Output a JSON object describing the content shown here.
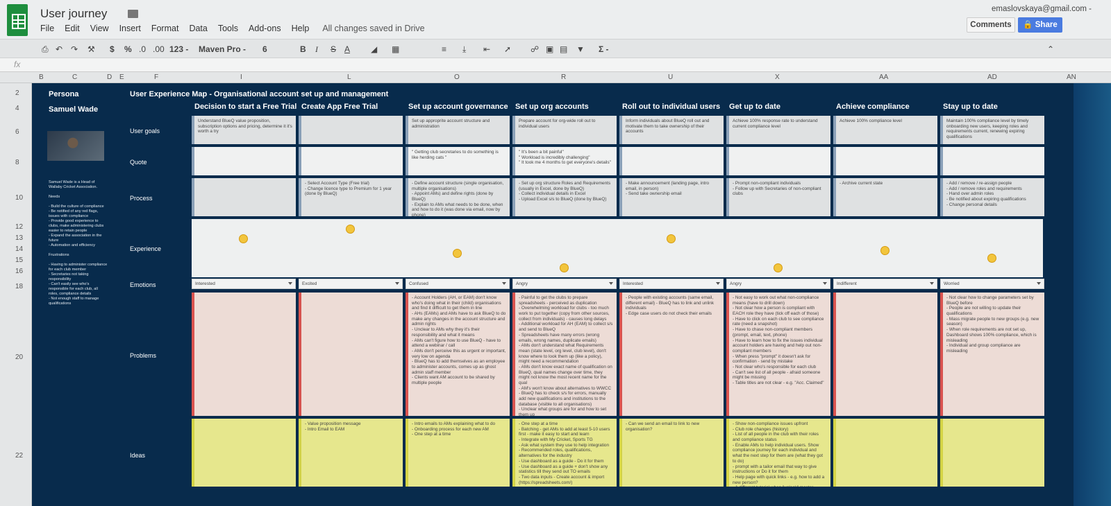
{
  "app": {
    "title": "User journey",
    "menu": [
      "File",
      "Edit",
      "View",
      "Insert",
      "Format",
      "Data",
      "Tools",
      "Add-ons",
      "Help"
    ],
    "saved_status": "All changes saved in Drive",
    "account_email": "emaslovskaya@gmail.com -",
    "comments_label": "Comments",
    "share_label": "Share"
  },
  "toolbar": {
    "currency": "$",
    "percent": "%",
    "dec_decrease": ".0",
    "dec_increase": ".00",
    "format_more": "123 -",
    "font": "Maven Pro -",
    "font_size": "6",
    "bold": "B",
    "italic": "I",
    "strike": "S",
    "text_color": "A",
    "sigma": "Σ -"
  },
  "formula_bar": {
    "fx": "fx"
  },
  "columns": [
    "B",
    "C",
    "D",
    "E",
    "F",
    "I",
    "L",
    "O",
    "R",
    "U",
    "X",
    "AA",
    "AD",
    "AN"
  ],
  "rows": [
    "2",
    "4",
    "6",
    "8",
    "10",
    "12",
    "13",
    "14",
    "15",
    "16",
    "18",
    "20",
    "22"
  ],
  "sheet": {
    "persona_label": "Persona",
    "map_title": "User Experience Map - Organisational account set up and management",
    "persona_name": "Samuel Wade",
    "persona_description": "Samuel Wade is a Head of Wallaby Cricket Association.\n\nNeeds\n\n- Build the culture of compliance\n- Be notified of any red flags, issues with compliance\n- Provide good experience to clubs, make administering clubs easier to retain people\n- Expand the association in the future\n- Automation and efficiency\n\nFrustrations\n\n- Having to administer compliance for each club member\n- Secretaries not taking responsibility\n- Can't easily see who's responsible for each club, all roles, compliance details\n- Not enough staff to manage qualifications",
    "row_labels": {
      "goals": "User goals",
      "quote": "Quote",
      "process": "Process",
      "experience": "Experience",
      "emotions": "Emotions",
      "problems": "Problems",
      "ideas": "Ideas"
    },
    "stages": [
      {
        "name": "Decision to start a Free Trial",
        "goal": "Understand BlueQ value proposition, subscription options and pricing, determine it it's worth a try",
        "quote": "",
        "process": "",
        "emotion": "Interested",
        "problems": "",
        "ideas": ""
      },
      {
        "name": "Create App Free Trial",
        "goal": "",
        "quote": "",
        "process": "- Select Account Type (Free trial)\n- Change licence type to Premium for 1 year (done by BlueQ)",
        "emotion": "Excited",
        "problems": "",
        "ideas": "- Value proposition message\n- Intro Email to EAM"
      },
      {
        "name": "Set up account governance",
        "goal": "Set up approprite account structure and administration",
        "quote": "\" Getting club secretaries to do something is like herding cats \"",
        "process": "- Define account structure (single organisation, multiple organisations)\n- Appoint AMs) and define rights (done by BlueQ)\n- Explain to AMs what needs to be done, when and how to do it (was done via email, now by phone)",
        "emotion": "Confused",
        "problems": "- Account Holders (AH, or EAM) don't know who's doing what in their (child) organisations and find it difficult to get them in line\n- AHs (EAMs) and AMs have to ask BlueQ to do make any changes in the account structure and admin rights\n- Unclear to AMs why they it's their responsibility and what it means\n- AMs can't figure how to use BlueQ - have to attend a webinar / call\n- AMs don't perceive this as urgent or important, very low on agenda\n- BlueQ has to add themselves as an employee to administer accounts, comes up as ghost admin staff member\n- Clients want AM account to be shared by multiple people",
        "ideas": "- Intro emails to AMs explaining what to do\n- Onboarding process for each new AM\n- One step at a time"
      },
      {
        "name": "Set up org accounts",
        "goal": "Prepare account for org-wide roll out to individual users",
        "quote": "\" It's been a bit painful\"\n\" Workload is incredibly challenging\"\n\" It took me 4 months to get everyone's details\"",
        "process": "- Set up org structure Roles and Requirements (usually in Excel, done by BlueQ)\n- Collect individual details in Excel\n- Upload Excel s/s to BlueQ (done by BlueQ)",
        "emotion": "Angry",
        "problems": "- Painful to get the clubs to prepare spreadsheets - perceived as duplication\n- Overwhelming workload for clubs - too much work to put together (copy from other sources, collect from individuals) - causes long delays\n- Additional workload for AH (EAM) to collect s/s and send to BlueQ\n- Spreadsheets have many errors (wrong emails, wrong names, duplicate emails)\n- AMs don't understand what Requirements mean (state level, org level, club level), don't know where to look them up (like a policy), might need a recommendation\n- AMs don't know exact name of qualification on BlueQ, qual names change over time, they might not know the most recent name for the qual\n- AM's won't know about alternatives to WWCC\n- BlueQ has to check s/s for errors, manually add new qualifications and institutions to the database (visible to all organisations)\n- Unclear what groups are for and how to set them up\n- BlueQ has to upload s/s",
        "ideas": "- One step at a time\n- Batching - get AMs to add at least 5-10 users first - make it easy to start and learn\n- Integrate with My Cricket, Sports TG\n- Ask what system they use to help integration\n- Recommended roles, qualifications, alternatives for the industry\n- Use dashboard as a guide - Do it for them\n- Use dashboard as a guide + don't show any statistics till they send out TO emails\n- Two data inputs - Create account & import (https://spreadsheets.com/)"
      },
      {
        "name": "Roll out to individual users",
        "goal": "Inform individuals about BlueQ roll out and motivate them to take ownership of their accounts",
        "quote": "",
        "process": "- Make announcement (landing page, intro email, in person)\n- Send take ownership email",
        "emotion": "Interested",
        "problems": "- People with existing accounts (same email, different email) - BlueQ has to link and unlink individuals\n- Edge case users do not check their emails",
        "ideas": "- Can we send an email to link to new organisation?"
      },
      {
        "name": "Get up to date",
        "goal": "Achieve 100% response rate to understand current compliance level",
        "quote": "",
        "process": "- Prompt non-compliant individuals\n- Follow up with Secretaries of non-compliant clubs",
        "emotion": "Angry",
        "problems": "- Not easy to work out what non-compliance means (have to drill down)\n- Not clear how a person is compliant with EACH role they have (tick off each of those)\n- Have to click on each club to see compliance rate (need a snapshot)\n- Have to chase non-compliant members (prompt, email, text, phone)\n- Have to learn how to fix the issues individual account holders are having and help out non-compliant members\n- When press \"prompt\" it doesn't ask for confirmation - send by mistake\n- Not clear who's responsible for each club\n- Can't see list of all people - afraid someone might be missing\n- Table titles are not clear - e.g. \"Acc. Claimed\"",
        "ideas": "- Show non-compliance issues upfront\n- Club role changes (history)\n- List of all people in the club with their roles and compliance status\n- Enable AMs to help individual users. Show compliance journey for each individual and what the next step for them are (what they got to do)\n- prompt with a tailor email that way to give instructions or Do it for them\n- Help page with quick links - e.g. how to add a new person?\n- A different tutorial when \"unlock\" master account"
      },
      {
        "name": "Achieve compliance",
        "goal": "Achieve 100% compliance level",
        "quote": "",
        "process": "- Archive current state",
        "emotion": "Indifferent",
        "problems": "",
        "ideas": ""
      },
      {
        "name": "Stay up to date",
        "goal": "Maintain 100% compliance level by timely onboarding new users, keeping roles and requirements current, renewing expiring qualifications",
        "quote": "",
        "process": "- Add / remove / re-assign people\n- Add / remove roles and requirements\n- Hand over admin roles\n- Be notified about expiring qualifications\n- Change personal details",
        "emotion": "Worried",
        "problems": "- Not clear how to change parameters set by BlueQ before\n- People are not willing to update their qualifications\n- Mass migrate people to new groups (e.g. new season)\n- When role requirements are not set up, Dashboard shows 100% compliance, which is misleading\n- Individual and group compliance are misleading",
        "ideas": ""
      }
    ],
    "experience_levels": [
      0.75,
      0.95,
      0.45,
      0.15,
      0.75,
      0.15,
      0.5,
      0.35
    ]
  }
}
